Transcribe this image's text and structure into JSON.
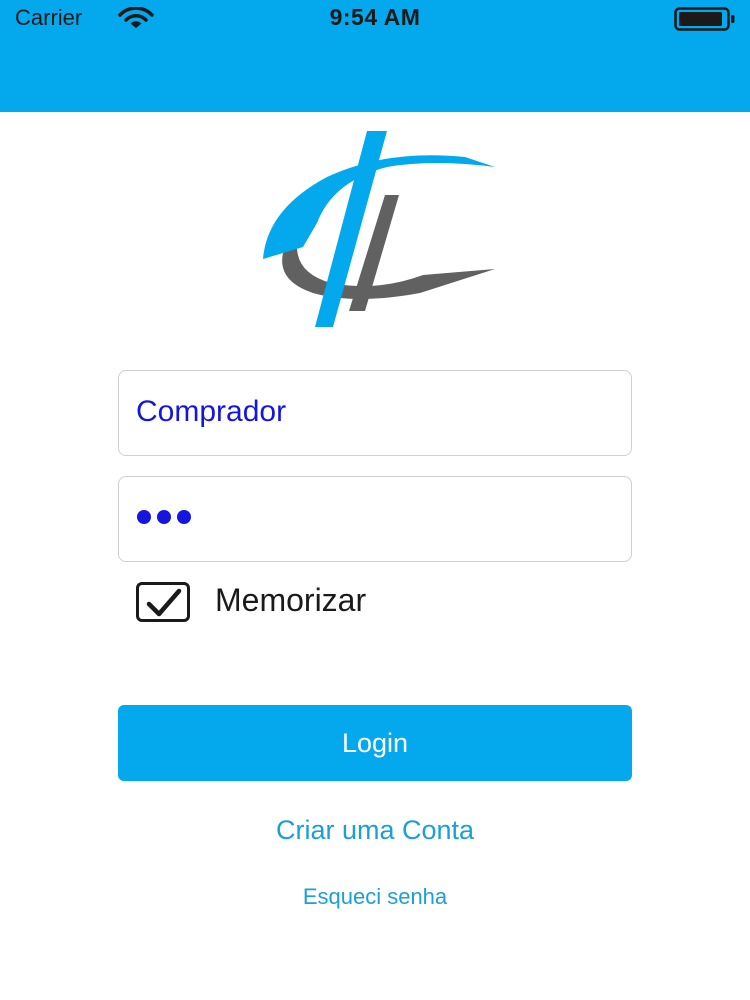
{
  "status_bar": {
    "carrier": "Carrier",
    "time": "9:54 AM",
    "wifi_icon": "wifi-icon",
    "battery_icon": "battery-icon"
  },
  "logo": {
    "icon": "cl-logo",
    "colors": {
      "blue": "#03a9ec",
      "gray": "#616161"
    }
  },
  "form": {
    "username_value": "Comprador",
    "password_masked": "•••",
    "remember_checked": true,
    "remember_label": "Memorizar"
  },
  "actions": {
    "login_label": "Login",
    "create_account_label": "Criar uma Conta",
    "forgot_password_label": "Esqueci senha"
  },
  "colors": {
    "accent": "#03a9ec",
    "input_text": "#1515e0",
    "link": "#1b9fd6"
  }
}
